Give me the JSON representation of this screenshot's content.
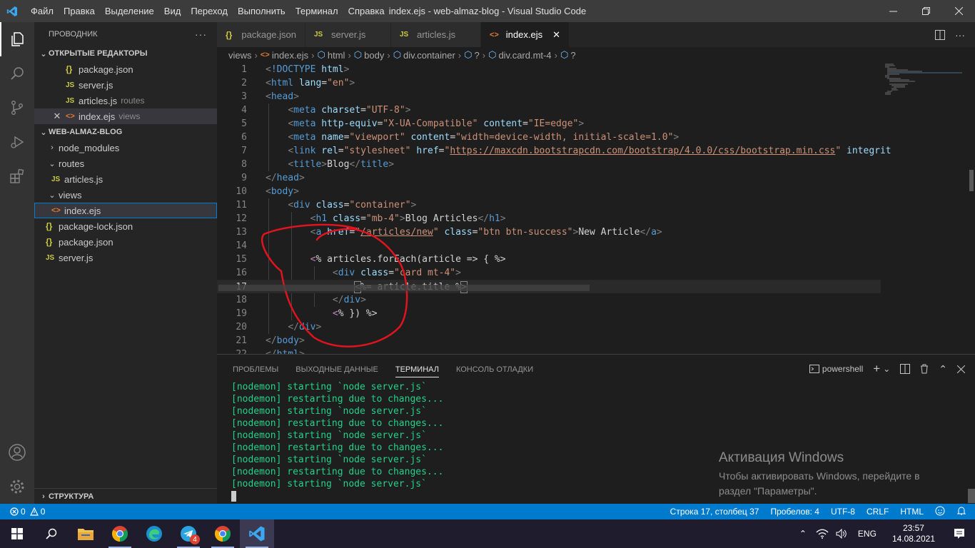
{
  "titlebar": {
    "menu": [
      "Файл",
      "Правка",
      "Выделение",
      "Вид",
      "Переход",
      "Выполнить",
      "Терминал",
      "Справка"
    ],
    "title": "index.ejs - web-almaz-blog - Visual Studio Code"
  },
  "sidebar": {
    "header": "ПРОВОДНИК",
    "open_editors_label": "ОТКРЫТЫЕ РЕДАКТОРЫ",
    "open_editors": [
      {
        "name": "package.json",
        "desc": ""
      },
      {
        "name": "server.js",
        "desc": ""
      },
      {
        "name": "articles.js",
        "desc": "routes"
      },
      {
        "name": "index.ejs",
        "desc": "views"
      }
    ],
    "project_label": "WEB-ALMAZ-BLOG",
    "tree": {
      "node_modules": "node_modules",
      "routes": "routes",
      "articles": "articles.js",
      "views": "views",
      "index": "index.ejs",
      "package_lock": "package-lock.json",
      "package": "package.json",
      "server": "server.js"
    },
    "structure_label": "СТРУКТУРА"
  },
  "tabs": [
    "package.json",
    "server.js",
    "articles.js",
    "index.ejs"
  ],
  "breadcrumbs": [
    "views",
    "index.ejs",
    "html",
    "body",
    "div.container",
    "?",
    "div.card.mt-4",
    "?"
  ],
  "editor": {
    "line_numbers": [
      "1",
      "2",
      "3",
      "4",
      "5",
      "6",
      "7",
      "8",
      "9",
      "10",
      "11",
      "12",
      "13",
      "14",
      "15",
      "16",
      "17",
      "18",
      "19",
      "20",
      "21",
      "22"
    ],
    "current_line": 17
  },
  "panel": {
    "tabs": [
      "ПРОБЛЕМЫ",
      "ВЫХОДНЫЕ ДАННЫЕ",
      "ТЕРМИНАЛ",
      "КОНСОЛЬ ОТЛАДКИ"
    ],
    "shell": "powershell",
    "terminal_lines": [
      "[nodemon] starting `node server.js`",
      "[nodemon] restarting due to changes...",
      "[nodemon] starting `node server.js`",
      "[nodemon] restarting due to changes...",
      "[nodemon] starting `node server.js`",
      "[nodemon] restarting due to changes...",
      "[nodemon] starting `node server.js`",
      "[nodemon] restarting due to changes...",
      "[nodemon] starting `node server.js`"
    ],
    "activation_title": "Активация Windows",
    "activation_line1": "Чтобы активировать Windows, перейдите в",
    "activation_line2": "раздел \"Параметры\"."
  },
  "statusbar": {
    "errors": "0",
    "warnings": "0",
    "position": "Строка 17, столбец 37",
    "spaces": "Пробелов: 4",
    "encoding": "UTF-8",
    "eol": "CRLF",
    "language": "HTML"
  },
  "taskbar": {
    "telegram_badge": "4",
    "lang": "ENG",
    "time": "23:57",
    "date": "14.08.2021"
  },
  "colors": {
    "accent": "#007acc",
    "terminal_text": "#23d18b",
    "annotation_circle": "#e0141e"
  }
}
